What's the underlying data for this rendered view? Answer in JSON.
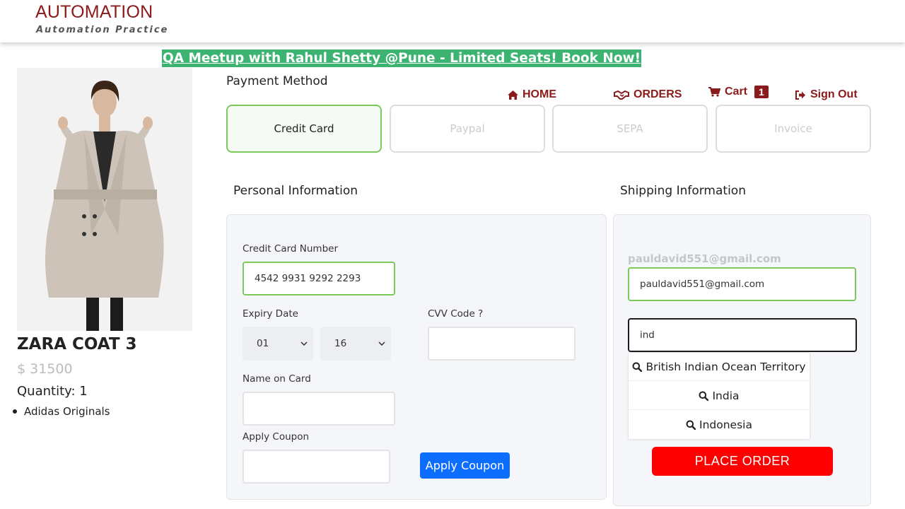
{
  "header": {
    "logo_title": "AUTOMATION",
    "logo_subtitle": "Automation Practice"
  },
  "banner": {
    "text": "QA Meetup with Rahul Shetty @Pune - Limited Seats! Book Now!"
  },
  "nav": {
    "home": "HOME",
    "orders": "ORDERS",
    "cart": "Cart",
    "cart_count": "1",
    "sign_out": "Sign Out"
  },
  "product": {
    "name": "ZARA COAT 3",
    "price": "$ 31500",
    "quantity": "Quantity: 1",
    "brand": "Adidas Originals"
  },
  "payment": {
    "title": "Payment Method",
    "methods": [
      "Credit Card",
      "Paypal",
      "SEPA",
      "Invoice"
    ],
    "selected": "Credit Card"
  },
  "personal": {
    "title": "Personal Information",
    "cc_label": "Credit Card Number",
    "cc_value": "4542 9931 9292 2293",
    "expiry_label": "Expiry Date",
    "expiry_month": "01",
    "expiry_year": "16",
    "cvv_label": "CVV Code ?",
    "cvv_value": "",
    "name_label": "Name on Card",
    "name_value": "",
    "coupon_label": "Apply Coupon",
    "coupon_value": "",
    "apply_button": "Apply Coupon"
  },
  "shipping": {
    "title": "Shipping Information",
    "email_display": "pauldavid551@gmail.com",
    "email_value": "pauldavid551@gmail.com",
    "country_value": "ind",
    "suggestions": [
      "British Indian Ocean Territory",
      "India",
      "Indonesia"
    ],
    "place_order": "PLACE ORDER"
  },
  "colors": {
    "brand": "#8b1a1a",
    "banner": "#3cb371",
    "selected_border": "#7cc95b",
    "apply_button": "#0d6efd",
    "place_order": "#ff0000"
  }
}
